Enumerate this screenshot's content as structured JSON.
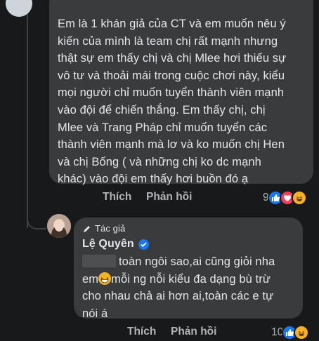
{
  "comment": {
    "lines": [
      "Em là 1 khán giả của CT và em muốn nêu ý",
      "kiến của mình là team chị rất mạnh nhưng",
      "thật sự em thấy chị và chị Mlee hơi thiếu sự",
      "vô tư và thoải mái trong cuộc chơi này, kiểu",
      "mọi người chỉ muốn tuyển thành viên mạnh",
      "vào đội để chiến thắng. Em thấy chị, chị",
      "Mlee và Trang Pháp chỉ muốn tuyển các",
      "thành viên mạnh mà lơ và ko muốn chị Hen",
      "và chị Bống ( và những chị ko dc mạnh",
      "khác) vào đội em thấy hơi buồn đó ạ"
    ],
    "like_label": "Thích",
    "reply_label": "Phản hồi",
    "reaction_count": "9",
    "reaction_icons": [
      "like-icon",
      "love-icon",
      "haha-icon"
    ]
  },
  "reply": {
    "badge_label": "Tác giả",
    "author": "Lệ Quyên",
    "line1": "toàn ngôi sao,ai cũng giỏi nha",
    "line2_prefix": "em",
    "line2_suffix": "mỗi ng nỗi kiểu đa dạng bù trừ",
    "line3": "cho nhau chả ai hơn ai,toàn các e tự",
    "line4": "nói á",
    "like_label": "Thích",
    "reply_label": "Phản hồi",
    "reaction_count": "10",
    "reaction_icons": [
      "like-icon",
      "haha-icon"
    ]
  },
  "colors": {
    "background": "#18191a",
    "bubble": "#3a3b3c",
    "text": "#e4e6eb",
    "muted": "#b0b3b8",
    "like_blue": "#1877f2",
    "love_red": "#f33e58",
    "haha_yellow": "#f7b125"
  }
}
